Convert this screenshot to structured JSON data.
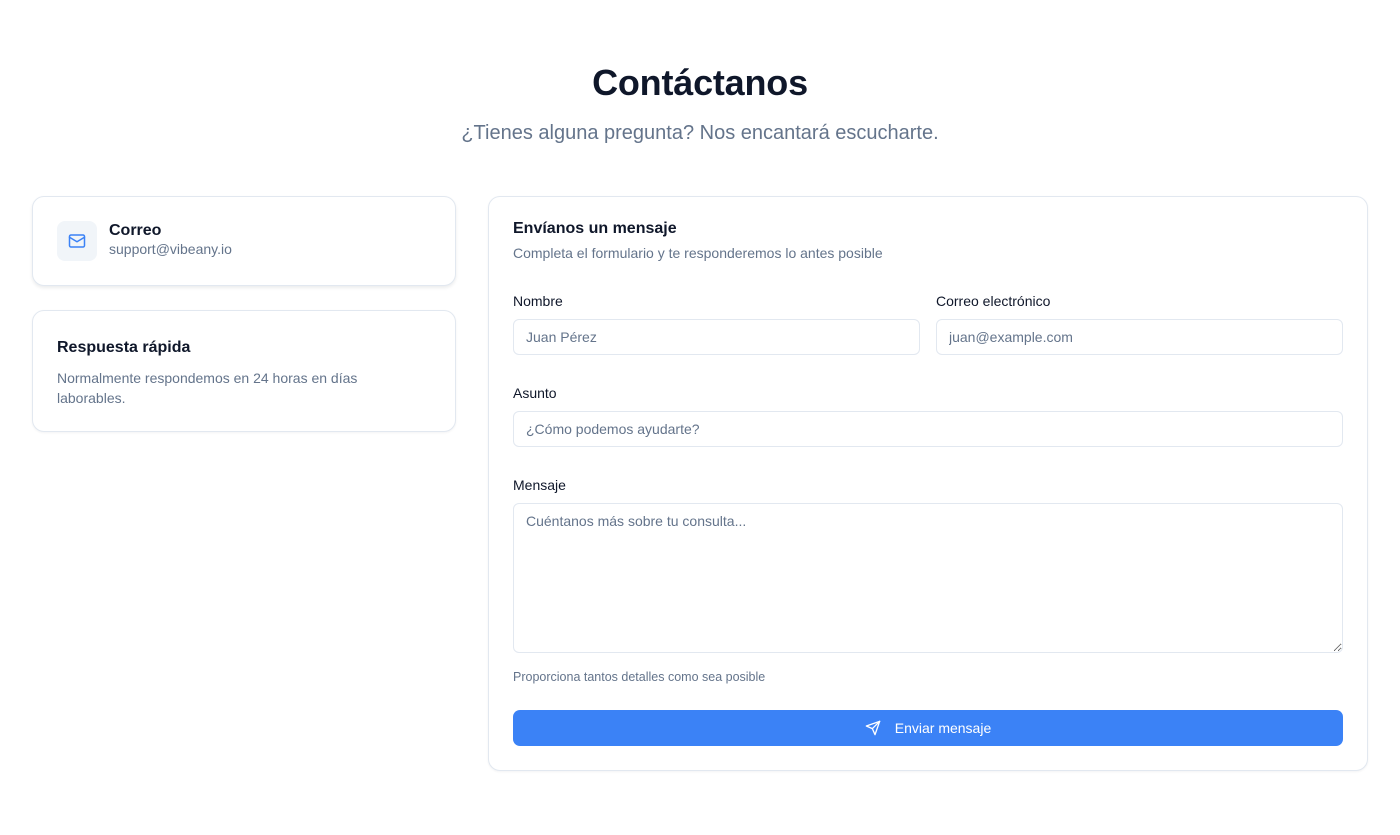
{
  "header": {
    "title": "Contáctanos",
    "subtitle": "¿Tienes alguna pregunta? Nos encantará escucharte."
  },
  "email_card": {
    "icon": "mail-icon",
    "title": "Correo",
    "value": "support@vibeany.io"
  },
  "quick_card": {
    "title": "Respuesta rápida",
    "text": "Normalmente respondemos en 24 horas en días laborables."
  },
  "form": {
    "title": "Envíanos un mensaje",
    "description": "Completa el formulario y te responderemos lo antes posible",
    "name": {
      "label": "Nombre",
      "placeholder": "Juan Pérez",
      "value": ""
    },
    "email": {
      "label": "Correo electrónico",
      "placeholder": "juan@example.com",
      "value": ""
    },
    "subject": {
      "label": "Asunto",
      "placeholder": "¿Cómo podemos ayudarte?",
      "value": ""
    },
    "message": {
      "label": "Mensaje",
      "placeholder": "Cuéntanos más sobre tu consulta...",
      "value": ""
    },
    "helper": "Proporciona tantos detalles como sea posible",
    "submit": {
      "label": "Enviar mensaje",
      "icon": "send-icon"
    }
  },
  "colors": {
    "accent": "#3b82f6",
    "text_primary": "#0f172a",
    "text_muted": "#64748b",
    "border": "#e2e8f0"
  }
}
